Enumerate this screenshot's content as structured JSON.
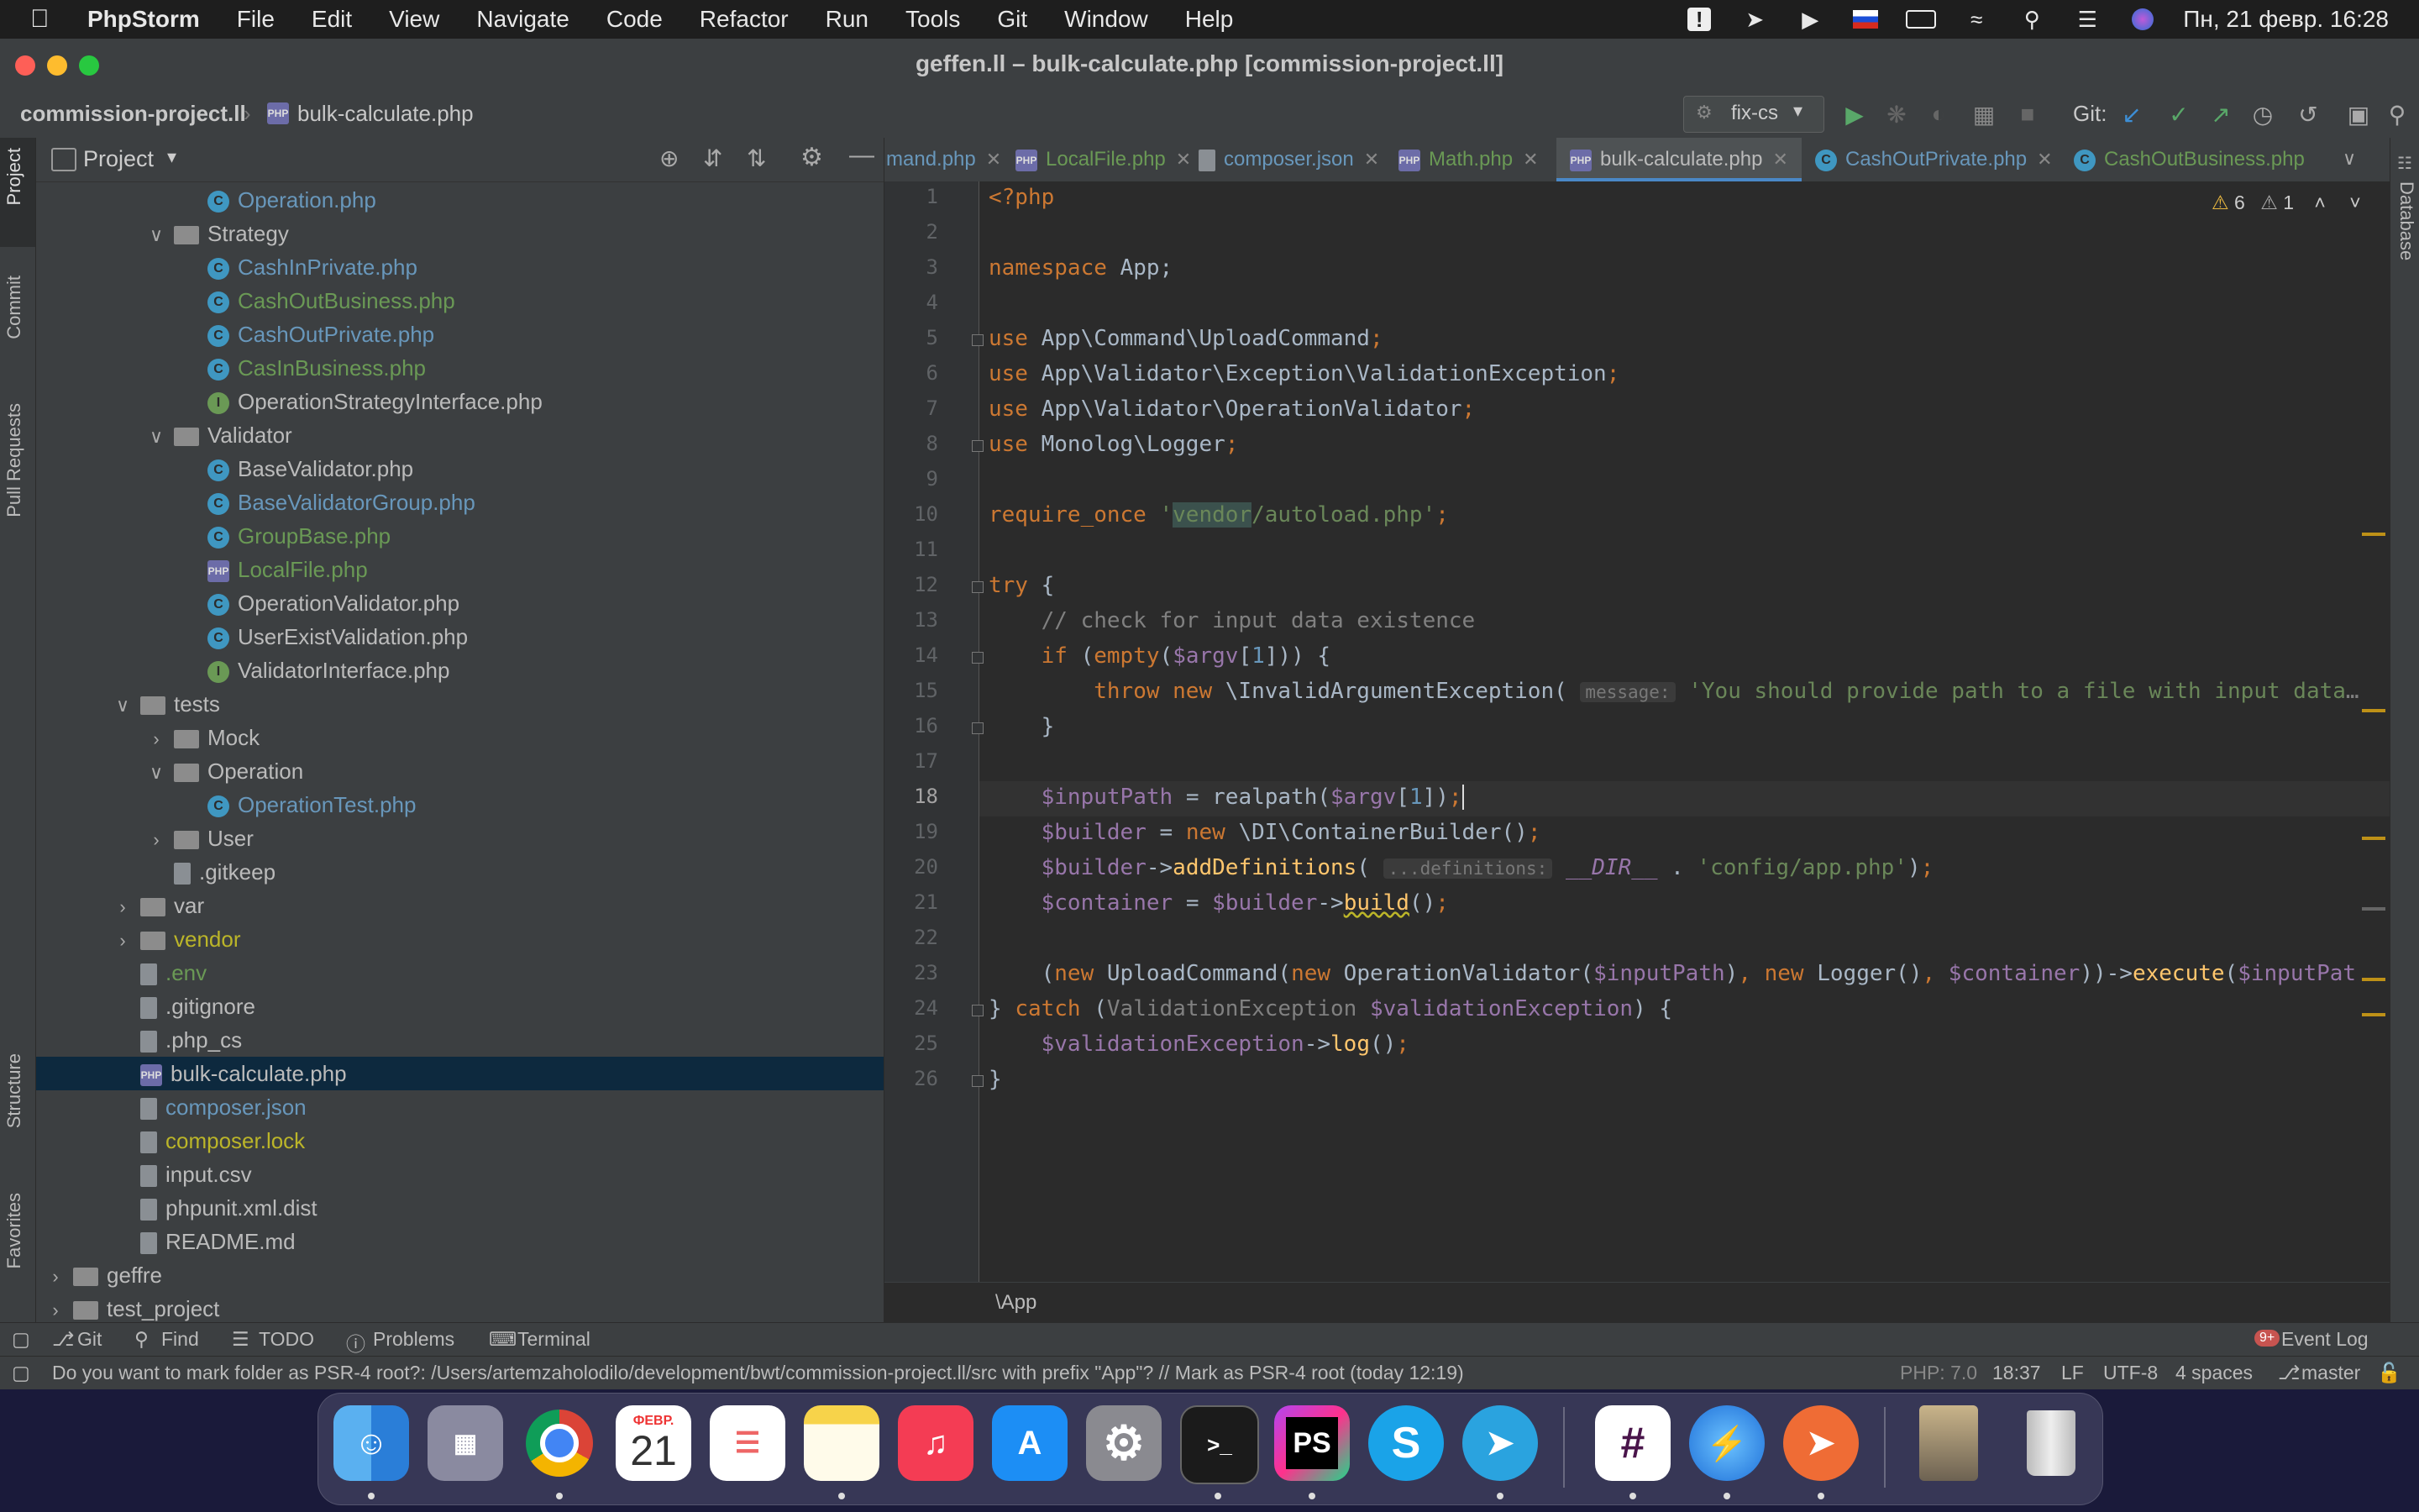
{
  "menubar": {
    "app": "PhpStorm",
    "items": [
      "File",
      "Edit",
      "View",
      "Navigate",
      "Code",
      "Refactor",
      "Run",
      "Tools",
      "Git",
      "Window",
      "Help"
    ],
    "clock": "Пн, 21 февр.  16:28"
  },
  "window": {
    "title": "geffen.ll – bulk-calculate.php [commission-project.ll]"
  },
  "navbar": {
    "project": "commission-project.ll",
    "file": "bulk-calculate.php",
    "branch_config": "fix-cs",
    "git_label": "Git:"
  },
  "sidetabs": {
    "project": "Project",
    "commit": "Commit",
    "pull": "Pull Requests",
    "structure": "Structure",
    "favorites": "Favorites",
    "database": "Database"
  },
  "project_panel": {
    "title": "Project",
    "tree": [
      {
        "label": "Operation.php",
        "icon": "c",
        "indent": 5,
        "color": "#6897bb"
      },
      {
        "label": "Strategy",
        "icon": "folder",
        "indent": 4,
        "arrow": "open",
        "color": "#bbbbbb"
      },
      {
        "label": "CashInPrivate.php",
        "icon": "c",
        "indent": 5,
        "color": "#6897bb"
      },
      {
        "label": "CashOutBusiness.php",
        "icon": "c",
        "indent": 5,
        "color": "#6a9955"
      },
      {
        "label": "CashOutPrivate.php",
        "icon": "c",
        "indent": 5,
        "color": "#6897bb"
      },
      {
        "label": "CasInBusiness.php",
        "icon": "c",
        "indent": 5,
        "color": "#6a9955"
      },
      {
        "label": "OperationStrategyInterface.php",
        "icon": "i",
        "indent": 5,
        "color": "#bbbbbb"
      },
      {
        "label": "Validator",
        "icon": "folder",
        "indent": 4,
        "arrow": "open",
        "color": "#bbbbbb"
      },
      {
        "label": "BaseValidator.php",
        "icon": "c",
        "indent": 5,
        "color": "#bbbbbb"
      },
      {
        "label": "BaseValidatorGroup.php",
        "icon": "c",
        "indent": 5,
        "color": "#6897bb"
      },
      {
        "label": "GroupBase.php",
        "icon": "c",
        "indent": 5,
        "color": "#6a9955"
      },
      {
        "label": "LocalFile.php",
        "icon": "php",
        "indent": 5,
        "color": "#6a9955"
      },
      {
        "label": "OperationValidator.php",
        "icon": "c",
        "indent": 5,
        "color": "#bbbbbb"
      },
      {
        "label": "UserExistValidation.php",
        "icon": "c",
        "indent": 5,
        "color": "#bbbbbb"
      },
      {
        "label": "ValidatorInterface.php",
        "icon": "i",
        "indent": 5,
        "color": "#bbbbbb"
      },
      {
        "label": "tests",
        "icon": "folder",
        "indent": 3,
        "arrow": "open",
        "color": "#bbbbbb"
      },
      {
        "label": "Mock",
        "icon": "folder",
        "indent": 4,
        "arrow": "closed",
        "color": "#bbbbbb"
      },
      {
        "label": "Operation",
        "icon": "folder",
        "indent": 4,
        "arrow": "open",
        "color": "#bbbbbb"
      },
      {
        "label": "OperationTest.php",
        "icon": "c",
        "indent": 5,
        "color": "#6897bb"
      },
      {
        "label": "User",
        "icon": "folder",
        "indent": 4,
        "arrow": "closed",
        "color": "#bbbbbb"
      },
      {
        "label": ".gitkeep",
        "icon": "file",
        "indent": 4,
        "color": "#bbbbbb"
      },
      {
        "label": "var",
        "icon": "folder",
        "indent": 3,
        "arrow": "closed",
        "color": "#bbbbbb"
      },
      {
        "label": "vendor",
        "icon": "folder",
        "indent": 3,
        "arrow": "closed",
        "color": "#bbb529"
      },
      {
        "label": ".env",
        "icon": "file",
        "indent": 3,
        "color": "#6a9955"
      },
      {
        "label": ".gitignore",
        "icon": "file",
        "indent": 3,
        "color": "#bbbbbb"
      },
      {
        "label": ".php_cs",
        "icon": "file",
        "indent": 3,
        "color": "#bbbbbb"
      },
      {
        "label": "bulk-calculate.php",
        "icon": "php",
        "indent": 3,
        "color": "#bbbbbb",
        "selected": true
      },
      {
        "label": "composer.json",
        "icon": "file",
        "indent": 3,
        "color": "#6897bb"
      },
      {
        "label": "composer.lock",
        "icon": "file",
        "indent": 3,
        "color": "#bbb529"
      },
      {
        "label": "input.csv",
        "icon": "file",
        "indent": 3,
        "color": "#bbbbbb"
      },
      {
        "label": "phpunit.xml.dist",
        "icon": "file",
        "indent": 3,
        "color": "#bbbbbb"
      },
      {
        "label": "README.md",
        "icon": "file",
        "indent": 3,
        "color": "#bbbbbb"
      },
      {
        "label": "geffre",
        "icon": "folder",
        "indent": 1,
        "arrow": "closed",
        "color": "#bbbbbb"
      },
      {
        "label": "test_project",
        "icon": "folder",
        "indent": 1,
        "arrow": "closed",
        "color": "#bbbbbb"
      }
    ]
  },
  "tabs": [
    {
      "label": "mand.php",
      "color": "#6897bb"
    },
    {
      "label": "LocalFile.php",
      "color": "#6a9955"
    },
    {
      "label": "composer.json",
      "color": "#6897bb"
    },
    {
      "label": "Math.php",
      "color": "#6a9955"
    },
    {
      "label": "bulk-calculate.php",
      "color": "#bbbbbb",
      "active": true
    },
    {
      "label": "CashOutPrivate.php",
      "color": "#6897bb"
    },
    {
      "label": "CashOutBusiness.php",
      "color": "#6a9955"
    }
  ],
  "editor": {
    "warnings": "6",
    "weak_warnings": "1",
    "current_line": 18,
    "breadcrumb": "\\App"
  },
  "bottom_tools": [
    "Git",
    "Find",
    "TODO",
    "Problems",
    "Terminal"
  ],
  "event_log": "Event Log",
  "event_badge": "9+",
  "status": {
    "message": "Do you want to mark folder as PSR-4 root?: /Users/artemzaholodilo/development/bwt/commission-project.ll/src with prefix \"App\"? // Mark as PSR-4 root (today 12:19)",
    "php": "PHP: 7.0",
    "position": "18:37",
    "line_sep": "LF",
    "encoding": "UTF-8",
    "indent": "4 spaces",
    "branch": "master"
  },
  "dock": {
    "calendar_month": "ФЕВР.",
    "calendar_day": "21",
    "apps": [
      "Finder",
      "Launchpad",
      "Chrome",
      "Calendar",
      "Reminders",
      "Notes",
      "Music",
      "App Store",
      "System Preferences",
      "Terminal",
      "PhpStorm",
      "Skype",
      "Telegram",
      "Slack",
      "Electron",
      "Postman",
      "Photo",
      "Trash"
    ]
  }
}
